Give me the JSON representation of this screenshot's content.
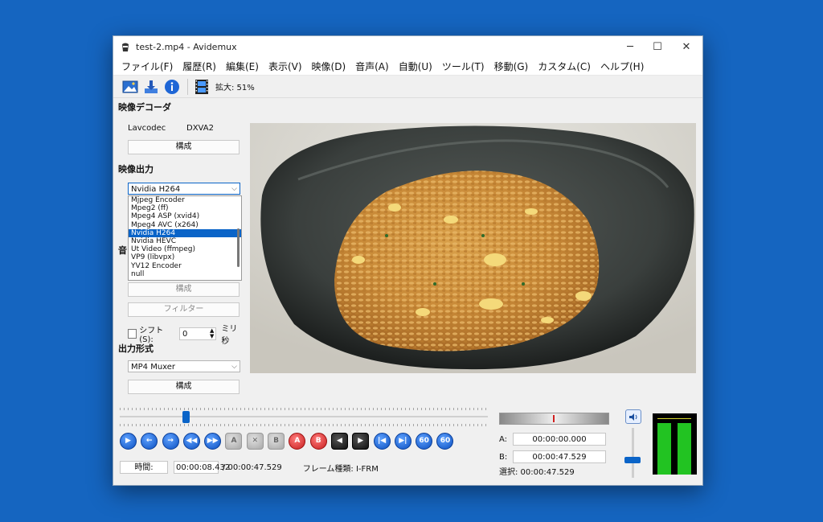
{
  "window": {
    "title": "test-2.mp4 - Avidemux",
    "min": "─",
    "max": "☐",
    "close": "✕"
  },
  "menu": [
    "ファイル(F)",
    "履歴(R)",
    "編集(E)",
    "表示(V)",
    "映像(D)",
    "音声(A)",
    "自動(U)",
    "ツール(T)",
    "移動(G)",
    "カスタム(C)",
    "ヘルプ(H)"
  ],
  "toolbar": {
    "zoom_label": "拡大: 51%"
  },
  "video_decoder": {
    "title": "映像デコーダ",
    "codec": "Lavcodec",
    "hw": "DXVA2",
    "config_label": "構成"
  },
  "video_output": {
    "title": "映像出力",
    "selected": "Nvidia H264",
    "options": [
      "Mjpeg Encoder",
      "Mpeg2 (ff)",
      "Mpeg4 ASP (xvid4)",
      "Mpeg4 AVC (x264)",
      "Nvidia H264",
      "Nvidia HEVC",
      "Ut Video (ffmpeg)",
      "VP9 (libvpx)",
      "YV12 Encoder",
      "null"
    ],
    "selected_index": 4
  },
  "audio_output": {
    "title_partial": "音",
    "config_label": "構成",
    "filter_label": "フィルター",
    "shift_label": "シフト(S):",
    "shift_value": "0",
    "shift_unit": "ミリ秒",
    "shift_checked": false
  },
  "output_format": {
    "title": "出力形式",
    "muxer": "MP4 Muxer",
    "config_label": "構成"
  },
  "seek": {
    "position_fraction": 0.18
  },
  "controls": [
    {
      "name": "play-button",
      "glyph": "▶",
      "style": "blue"
    },
    {
      "name": "prev-frame-button",
      "glyph": "←",
      "style": "blue"
    },
    {
      "name": "next-frame-button",
      "glyph": "→",
      "style": "blue"
    },
    {
      "name": "rewind-button",
      "glyph": "◀◀",
      "style": "blue"
    },
    {
      "name": "forward-button",
      "glyph": "▶▶",
      "style": "blue"
    },
    {
      "name": "set-marker-a-button",
      "glyph": "A",
      "style": "gray"
    },
    {
      "name": "delete-button",
      "glyph": "✕",
      "style": "gray"
    },
    {
      "name": "set-marker-b-button",
      "glyph": "B",
      "style": "gray"
    },
    {
      "name": "goto-marker-a-button",
      "glyph": "A",
      "style": "red"
    },
    {
      "name": "goto-marker-b-button",
      "glyph": "B",
      "style": "red"
    },
    {
      "name": "prev-keyframe-button",
      "glyph": "◀",
      "style": "dark"
    },
    {
      "name": "next-keyframe-button",
      "glyph": "▶",
      "style": "dark"
    },
    {
      "name": "first-frame-button",
      "glyph": "|◀",
      "style": "blue"
    },
    {
      "name": "last-frame-button",
      "glyph": "▶|",
      "style": "blue"
    },
    {
      "name": "back-60-button",
      "glyph": "60",
      "style": "blue"
    },
    {
      "name": "forward-60-button",
      "glyph": "60",
      "style": "blue"
    }
  ],
  "time": {
    "label": "時間:",
    "current": "00:00:08.432",
    "total": "/ 00:00:47.529",
    "frame_type": "フレーム種類: I-FRM"
  },
  "markers": {
    "a_label": "A:",
    "a_value": "00:00:00.000",
    "b_label": "B:",
    "b_value": "00:00:47.529",
    "selection": "選択: 00:00:47.529"
  },
  "volume": {
    "level_fraction": 0.35
  },
  "meter": {
    "left_fraction": 0.92,
    "right_fraction": 0.92
  },
  "colors": {
    "accent": "#0a64c8",
    "desktop": "#1565c0",
    "meter_green": "#22c322"
  }
}
